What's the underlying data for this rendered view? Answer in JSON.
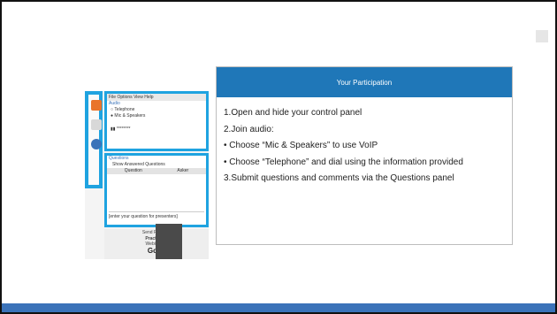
{
  "panel": {
    "menubar": "File  Options  View  Help",
    "audio_header": "Audio",
    "telephone_label": "Telephone",
    "mic_label": "Mic & Speakers",
    "pin_text": "▮▮  ********",
    "questions_header": "Questions",
    "show_answered": "Show Answered Questions",
    "col_question": "Question",
    "col_asker": "Asker",
    "question_placeholder": "[enter your question for presenters]",
    "send_label": "Send Privately",
    "practice_label": "Practice m",
    "webinar_id_label": "Webinar ID",
    "logo_text": "GoTo"
  },
  "card": {
    "title": "Your Participation",
    "lines": [
      "1.Open and hide your control panel",
      "2.Join audio:",
      "• Choose “Mic & Speakers” to use VoIP",
      "• Choose “Telephone” and dial using the information provided",
      "3.Submit questions and comments via the Questions panel"
    ]
  },
  "colors": {
    "accent_blue": "#1f77b8",
    "highlight_cyan": "#1fa3e0",
    "footer_blue": "#3b73b9",
    "orange": "#e9742b"
  }
}
